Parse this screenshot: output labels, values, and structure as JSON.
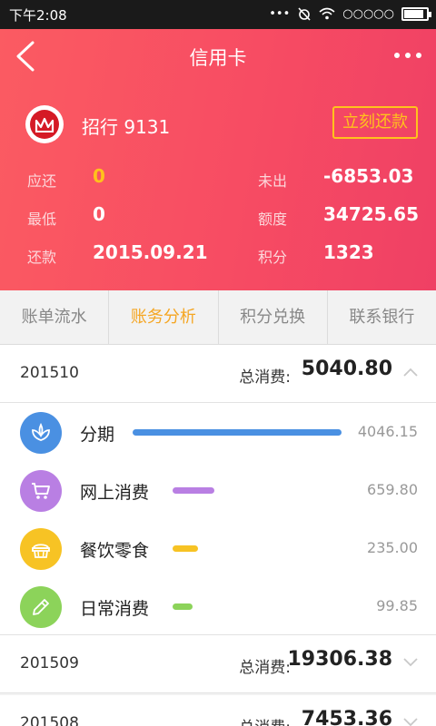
{
  "status_bar": {
    "time": "下午2:08",
    "signal": "○○○○○"
  },
  "nav": {
    "title": "信用卡"
  },
  "card": {
    "bank": "招行 9131",
    "repay_button": "立刻还款",
    "fields": [
      {
        "label": "应还",
        "value": "0",
        "highlight": true
      },
      {
        "label": "最低",
        "value": "0",
        "highlight": false
      },
      {
        "label": "还款",
        "value": "2015.09.21",
        "highlight": false
      },
      {
        "label": "未出",
        "value": "-6853.03",
        "highlight": false
      },
      {
        "label": "额度",
        "value": "34725.65",
        "highlight": false
      },
      {
        "label": "积分",
        "value": "1323",
        "highlight": false
      }
    ]
  },
  "tabs": [
    {
      "label": "账单流水",
      "active": false
    },
    {
      "label": "账务分析",
      "active": true
    },
    {
      "label": "积分兑换",
      "active": false
    },
    {
      "label": "联系银行",
      "active": false
    }
  ],
  "months": [
    {
      "month": "201510",
      "total_label": "总消费:",
      "total": "5040.80",
      "expanded": true
    },
    {
      "month": "201509",
      "total_label": "总消费:",
      "total": "19306.38",
      "expanded": false
    },
    {
      "month": "201508",
      "total_label": "总消费:",
      "total": "7453.36",
      "expanded": false
    }
  ],
  "categories": [
    {
      "name": "分期",
      "amount": "4046.15",
      "share": 0.8027,
      "color": "#4a90e2",
      "icon": "lotus-icon"
    },
    {
      "name": "网上消费",
      "amount": "659.80",
      "share": 0.1309,
      "color": "#b97fe3",
      "icon": "cart-icon"
    },
    {
      "name": "餐饮零食",
      "amount": "235.00",
      "share": 0.0466,
      "color": "#f7c324",
      "icon": "cake-icon"
    },
    {
      "name": "日常消费",
      "amount": "99.85",
      "share": 0.0198,
      "color": "#8cd35a",
      "icon": "pencil-icon"
    }
  ],
  "colors": {
    "accent": "#f5a623",
    "hero": "#f74c63",
    "repay": "#ffc21c"
  }
}
